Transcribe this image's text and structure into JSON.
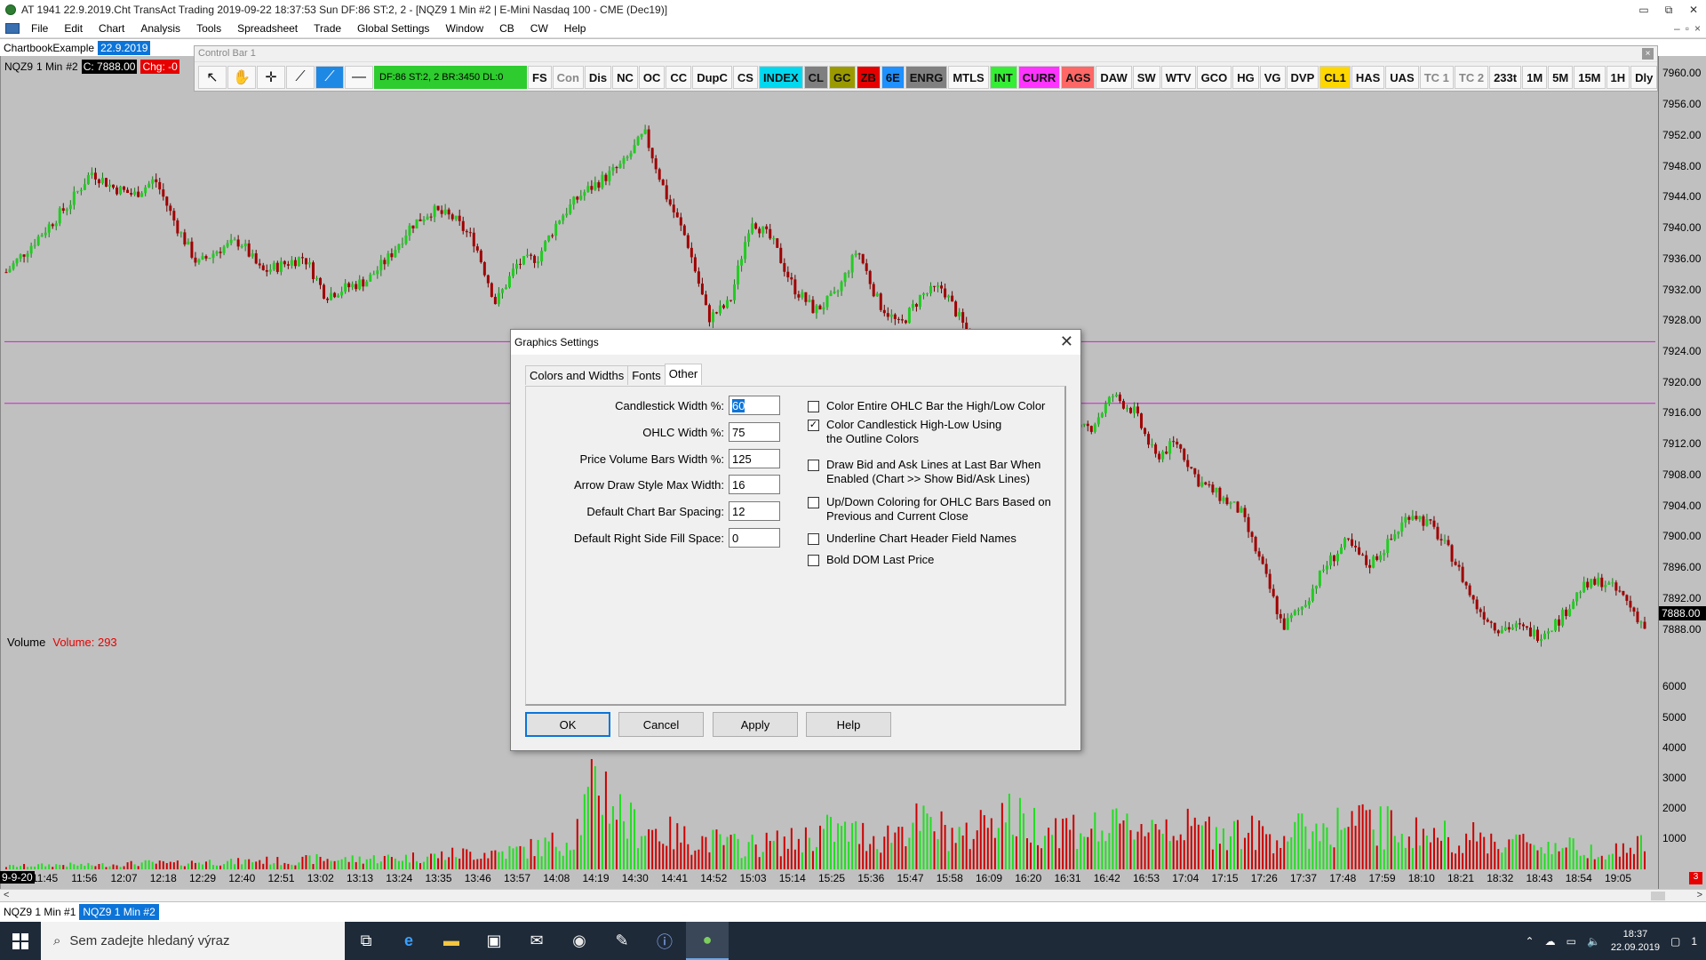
{
  "window": {
    "title": "AT 1941 22.9.2019.Cht  TransAct Trading 2019-09-22  18:37:53 Sun  DF:86  ST:2, 2 - [NQZ9  1 Min   #2 | E-Mini Nasdaq 100 - CME (Dec19)]",
    "min": "▭",
    "max": "⧉",
    "close": "✕"
  },
  "menu": [
    "File",
    "Edit",
    "Chart",
    "Analysis",
    "Tools",
    "Spreadsheet",
    "Trade",
    "Global Settings",
    "Window",
    "CB",
    "CW",
    "Help"
  ],
  "chartbook": {
    "name": "ChartbookExample",
    "date": "22.9.2019"
  },
  "controlbar": {
    "title": "Control Bar 1",
    "close": "×",
    "status": "DF:86  ST:2, 2   BR:3450  DL:0",
    "tools": [
      "FS",
      "Con",
      "Dis",
      "NC",
      "OC",
      "CC",
      "DupC",
      "CS",
      "INDEX",
      "CL",
      "GC",
      "ZB",
      "6E",
      "ENRG",
      "MTLS",
      "INT",
      "CURR",
      "AGS",
      "DAW",
      "SW",
      "WTV",
      "GCO",
      "HG",
      "VG",
      "DVP",
      "CL1",
      "HAS",
      "UAS",
      "TC 1",
      "TC 2",
      "233t",
      "1M",
      "5M",
      "15M",
      "1H",
      "Dly"
    ],
    "colors": {
      "INDEX": "#00d8f0",
      "CL": "#7f7f7f",
      "GC": "#9a9a00",
      "ZB": "#e60000",
      "6E": "#1e90ff",
      "ENRG": "#808080",
      "INT": "#33ee33",
      "CURR": "#ff33ff",
      "AGS": "#ff6666",
      "CL1": "#ffd700"
    }
  },
  "chart": {
    "symbol": "NQZ9",
    "interval": "1 Min",
    "id": "#2",
    "close": "C: 7888.00",
    "change": "Chg: -0",
    "volume_label": "Volume",
    "volume_value": "Volume: 293",
    "last_price": "7888.00",
    "price_ticks": [
      "7960.00",
      "7956.00",
      "7952.00",
      "7948.00",
      "7944.00",
      "7940.00",
      "7936.00",
      "7932.00",
      "7928.00",
      "7924.00",
      "7920.00",
      "7916.00",
      "7912.00",
      "7908.00",
      "7904.00",
      "7900.00",
      "7896.00",
      "7892.00",
      "7888.00"
    ],
    "volume_ticks": [
      "6000",
      "5000",
      "4000",
      "3000",
      "2000",
      "1000"
    ],
    "time_first": "9-9-20",
    "time_ticks": [
      "11:45",
      "11:56",
      "12:07",
      "12:18",
      "12:29",
      "12:40",
      "12:51",
      "13:02",
      "13:13",
      "13:24",
      "13:35",
      "13:46",
      "13:57",
      "14:08",
      "14:19",
      "14:30",
      "14:41",
      "14:52",
      "15:03",
      "15:14",
      "15:25",
      "15:36",
      "15:47",
      "15:58",
      "16:09",
      "16:20",
      "16:31",
      "16:42",
      "16:53",
      "17:04",
      "17:15",
      "17:26",
      "17:37",
      "17:48",
      "17:59",
      "18:10",
      "18:21",
      "18:32",
      "18:43",
      "18:54",
      "19:05"
    ],
    "badge": "3",
    "hlines": [
      7925.0,
      7917.0
    ]
  },
  "chart_data": {
    "type": "candlestick",
    "title": "",
    "xlabel": "",
    "ylabel": "",
    "ylim": [
      7886,
      7962
    ],
    "volume_ylim": [
      0,
      6600
    ],
    "x_range": [
      "11:34",
      "19:13"
    ],
    "price_path": [
      7934,
      7937,
      7940,
      7943,
      7947,
      7945,
      7944,
      7946,
      7940,
      7935,
      7937,
      7938,
      7934,
      7935,
      7936,
      7931,
      7932,
      7933,
      7936,
      7940,
      7942,
      7941,
      7938,
      7930,
      7935,
      7936,
      7941,
      7944,
      7946,
      7948,
      7952,
      7944,
      7938,
      7928,
      7930,
      7941,
      7938,
      7932,
      7929,
      7931,
      7937,
      7930,
      7927,
      7931,
      7932,
      7927,
      7920,
      7918,
      7921,
      7918,
      7913,
      7914,
      7918,
      7916,
      7910,
      7912,
      7907,
      7905,
      7903,
      7896,
      7888,
      7891,
      7896,
      7899,
      7896,
      7899,
      7903,
      7901,
      7897,
      7891,
      7888,
      7888,
      7887,
      7889,
      7893,
      7894,
      7892,
      7888
    ],
    "volume_path": [
      120,
      150,
      180,
      160,
      200,
      250,
      220,
      300,
      280,
      350,
      300,
      400,
      380,
      420,
      450,
      500,
      600,
      650,
      700,
      900,
      1200,
      3500,
      1800,
      1500,
      1200,
      1100,
      900,
      1000,
      1100,
      1500,
      1400,
      1200,
      1800,
      1600,
      1200,
      2400,
      1800,
      1700,
      1600,
      1500,
      1700,
      1800,
      1500,
      1600,
      1400,
      1300,
      1500,
      1700,
      1800,
      1600,
      1400,
      1300,
      1200,
      1100,
      1000,
      900,
      800,
      700,
      1000
    ]
  },
  "dialog": {
    "title": "Graphics Settings",
    "close": "✕",
    "tabs": [
      "Colors and Widths",
      "Fonts",
      "Other"
    ],
    "fields": [
      {
        "label": "Candlestick Width %:",
        "value": "60"
      },
      {
        "label": "OHLC Width %:",
        "value": "75"
      },
      {
        "label": "Price Volume Bars Width %:",
        "value": "125"
      },
      {
        "label": "Arrow Draw Style Max Width:",
        "value": "16"
      },
      {
        "label": "Default Chart Bar Spacing:",
        "value": "12"
      },
      {
        "label": "Default Right Side Fill Space:",
        "value": "0"
      }
    ],
    "checks": [
      {
        "label": "Color Entire OHLC Bar the High/Low Color",
        "checked": false
      },
      {
        "label": "Color Candlestick High-Low Using the Outline Colors",
        "checked": true
      },
      {
        "label": "Draw Bid and Ask Lines at Last Bar When Enabled (Chart >> Show Bid/Ask Lines)",
        "checked": false
      },
      {
        "label": "Up/Down Coloring for OHLC Bars Based on Previous and Current Close",
        "checked": false
      },
      {
        "label": "Underline Chart Header Field Names",
        "checked": false
      },
      {
        "label": "Bold DOM Last Price",
        "checked": false
      }
    ],
    "buttons": {
      "ok": "OK",
      "cancel": "Cancel",
      "apply": "Apply",
      "help": "Help"
    }
  },
  "chartbar": [
    {
      "label": "NQZ9  1 Min   #1",
      "active": false
    },
    {
      "label": "NQZ9  1 Min   #2",
      "active": true
    }
  ],
  "taskbar": {
    "search_placeholder": "Sem zadejte hledaný výraz",
    "time": "18:37",
    "date": "22.09.2019",
    "notif_count": "1"
  }
}
